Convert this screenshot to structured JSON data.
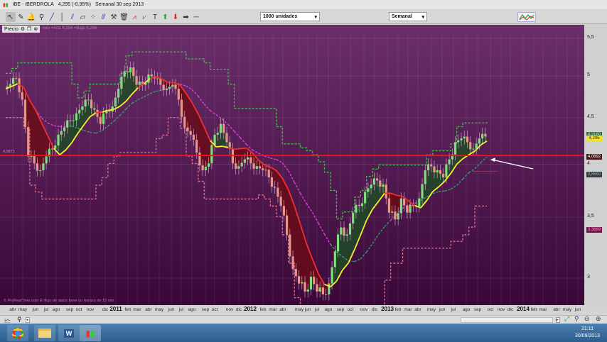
{
  "window": {
    "symbol": "IBE - IBERDROLA",
    "price": "4,295 (-0,95%)",
    "period": "Semanal 30 sep 2013"
  },
  "toolbar": {
    "icons": [
      "cursor-icon",
      "ruler-icon",
      "alert-bell-icon",
      "zoom-icon",
      "trendline-icon",
      "vertical-line-icon",
      "fibonacci-icon",
      "channel-icon",
      "scatter-icon",
      "parallel-lines-icon",
      "tools-icon",
      "trash-icon",
      "indicator-icon",
      "chart-type-icon",
      "text-icon",
      "arrow-up-icon",
      "arrow-down-icon",
      "arrow-right-icon",
      "horizontal-line-icon"
    ],
    "units_select": "1000 unidades",
    "period_select": "Semanal"
  },
  "chart_header": {
    "label": "Precio",
    "overlay_text": "Info +Alta 4,356 +Baja 4,256"
  },
  "chart_data": {
    "type": "candlestick",
    "title": "IBE - IBERDROLA Semanal",
    "scale": "log",
    "ylim": [
      2.85,
      5.6
    ],
    "yticks": [
      "5,5",
      "5",
      "4,5",
      "4",
      "3,5",
      "3"
    ],
    "ytick_values": [
      5.5,
      5,
      4.5,
      4,
      3.5,
      3
    ],
    "closes": [
      4.84,
      4.9,
      4.97,
      4.71,
      4.08,
      4.01,
      3.94,
      4.08,
      4.16,
      4.31,
      4.39,
      4.47,
      4.55,
      4.63,
      4.71,
      4.59,
      4.43,
      4.59,
      4.63,
      4.84,
      5.06,
      5.11,
      4.89,
      4.89,
      5.02,
      4.97,
      4.89,
      4.84,
      4.89,
      4.71,
      4.39,
      4.31,
      4.12,
      3.94,
      4.01,
      4.31,
      4.43,
      4.23,
      4.01,
      3.98,
      4.05,
      4.01,
      3.98,
      3.94,
      3.87,
      3.77,
      3.6,
      3.35,
      3.07,
      2.96,
      2.9,
      3.01,
      2.9,
      2.88,
      2.96,
      3.21,
      3.41,
      3.35,
      3.54,
      3.6,
      3.73,
      3.8,
      3.84,
      3.8,
      3.54,
      3.48,
      3.67,
      3.54,
      3.6,
      3.67,
      3.94,
      3.98,
      3.94,
      3.87,
      4.05,
      4.23,
      4.27,
      4.23,
      4.16,
      4.27,
      4.29
    ],
    "hline": 4.09,
    "hline_label": "4,0871",
    "short_line": 3.93,
    "x_labels": [
      "abr",
      "may",
      "jun",
      "jul",
      "ago",
      "sep",
      "oct",
      "nov",
      "dic",
      "2011",
      "feb",
      "mar",
      "abr",
      "may",
      "jun",
      "jul",
      "ago",
      "sep",
      "oct",
      "nov",
      "dic",
      "2012",
      "feb",
      "mar",
      "abr",
      "may",
      "jun",
      "jul",
      "ago",
      "sep",
      "oct",
      "nov",
      "dic",
      "2013",
      "feb",
      "mar",
      "abr",
      "may",
      "jun",
      "jul",
      "ago",
      "sep",
      "oct",
      "nov",
      "dic",
      "2014",
      "feb",
      "mar",
      "abr",
      "may",
      "jun"
    ],
    "price_tags": [
      {
        "text": "4,3160",
        "bg": "#3d6b3d",
        "fg": "#bfe0bf"
      },
      {
        "text": "4,295",
        "bg": "#f0e030",
        "fg": "#333"
      },
      {
        "text": "4,0892",
        "bg": "#4a1a1a",
        "fg": "#fff"
      },
      {
        "text": "3,8660",
        "bg": "#3a3a4a",
        "fg": "#8fb08f"
      },
      {
        "text": "3,3669",
        "bg": "#7a1050",
        "fg": "#f0a0c0"
      }
    ],
    "footer_note": "© ProRealTime.com  El flujo de datos tiene un retraso de 15 min"
  },
  "colors": {
    "up": "#7ede7e",
    "down": "#e8958a",
    "ma_up": "#f5f030",
    "ma_down": "#ee3030",
    "hline": "#ff1010"
  },
  "taskbar": {
    "apps": [
      "chrome",
      "explorer",
      "word",
      "prorealtime"
    ],
    "time": "21:11",
    "date": "30/09/2013"
  }
}
